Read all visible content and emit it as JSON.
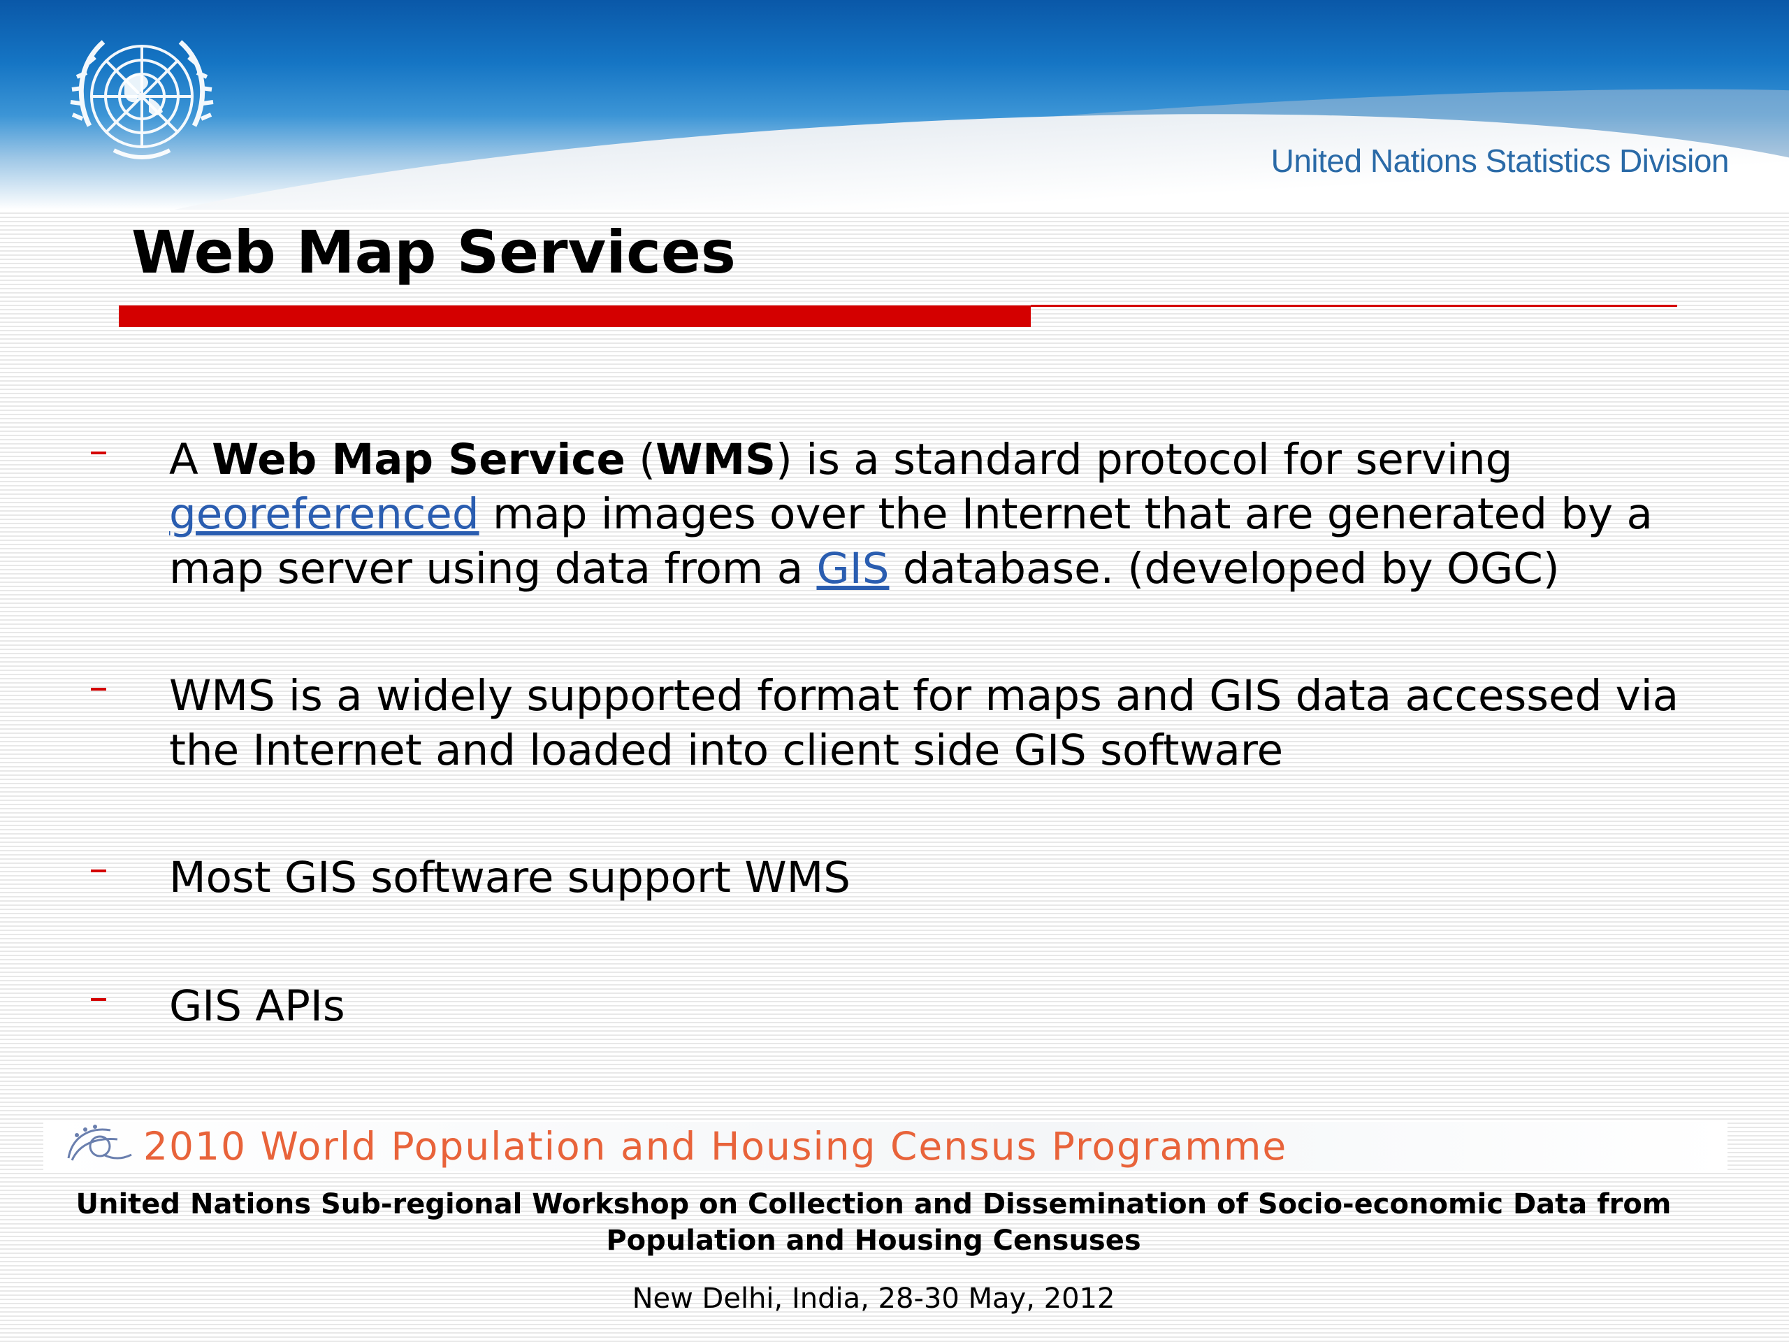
{
  "header": {
    "division": "United Nations Statistics Division",
    "logo_icon": "un-emblem-icon",
    "colors": {
      "top": "#0a58a8",
      "division_text": "#2a6aa7"
    }
  },
  "slide": {
    "title": "Web Map Services",
    "accent_color": "#d40000",
    "bullets": [
      {
        "p1": "A ",
        "b1": "Web Map Service",
        "p2": " (",
        "b2": "WMS",
        "p3": ") is a standard protocol for serving ",
        "link1": "georeferenced",
        "p4": " map images over the Internet that are generated by a map server using data from a ",
        "link2": "GIS",
        "p5": " database. (developed by OGC)"
      },
      {
        "text": "WMS is a widely supported format for maps and GIS data accessed via the Internet and loaded into client side GIS software"
      },
      {
        "text": "Most GIS software support WMS"
      },
      {
        "text": "GIS APIs"
      }
    ]
  },
  "footer": {
    "census_icon": "census-programme-logo-icon",
    "census_title": "2010 World Population and Housing Census Programme",
    "workshop": "United Nations Sub-regional Workshop on Collection and Dissemination of Socio-economic Data from Population and Housing Censuses",
    "place_date": "New Delhi, India, 28-30 May, 2012"
  }
}
